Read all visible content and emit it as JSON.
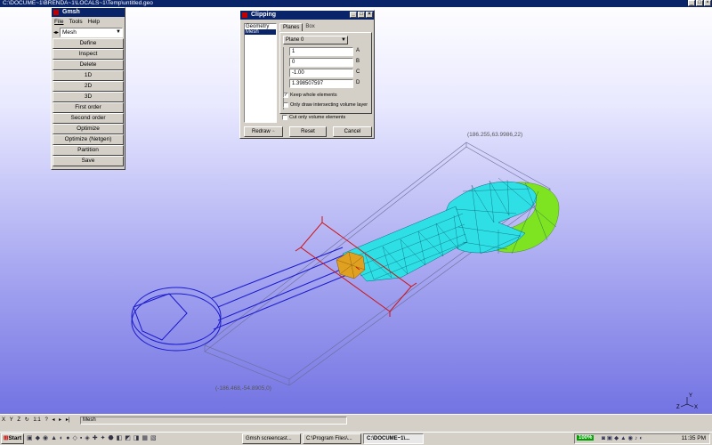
{
  "titlebar": {
    "title": "C:\\DOCUME~1\\BRENDA~1\\LOCALS~1\\Temp\\untitled.geo"
  },
  "gmsh": {
    "title": "Gmsh",
    "menu": [
      "File",
      "Tools",
      "Help"
    ],
    "module": "Mesh",
    "buttons": [
      "Define",
      "Inspect",
      "Delete",
      "1D",
      "2D",
      "3D",
      "First order",
      "Second order",
      "Optimize",
      "Optimize (Netgen)",
      "Partition",
      "Save"
    ]
  },
  "clipping": {
    "title": "Clipping",
    "list": [
      "Geometry",
      "Mesh"
    ],
    "tabs": [
      "Planes",
      "Box"
    ],
    "plane": "Plane 0",
    "fields": [
      {
        "value": "1",
        "label": "A"
      },
      {
        "value": "0",
        "label": "B"
      },
      {
        "value": "-1.00",
        "label": "C"
      },
      {
        "value": "1.398507597",
        "label": "D"
      }
    ],
    "options": [
      {
        "label": "Keep whole elements",
        "checked": true
      },
      {
        "label": "Only draw intersecting volume layer",
        "checked": false
      },
      {
        "label": "Cut only volume elements",
        "checked": false
      }
    ],
    "buttons": [
      "Redraw",
      "Reset",
      "Cancel"
    ]
  },
  "viewport": {
    "coord_top": "(186.255,63.9986,22)",
    "coord_bottom": "(-186.468,-54.8905,0)",
    "axes": [
      "Y",
      "Z",
      "X"
    ]
  },
  "status": {
    "buttons": [
      "X",
      "Y",
      "Z",
      "1:1",
      "?"
    ],
    "message": "Mesh"
  },
  "taskbar": {
    "start": "Start",
    "tasks": [
      "Gmsh screencast...",
      "C:\\Program Files\\...",
      "C:\\DOCUME~1\\..."
    ],
    "battery": "100%",
    "clock": "11:35 PM"
  },
  "colors": {
    "title_blue": "#0a246a",
    "mesh_cyan": "#2ee0e6",
    "mesh_green": "#7ee320",
    "mesh_orange": "#e0a020",
    "wire_blue": "#1a1acc",
    "plane_red": "#d01010"
  }
}
